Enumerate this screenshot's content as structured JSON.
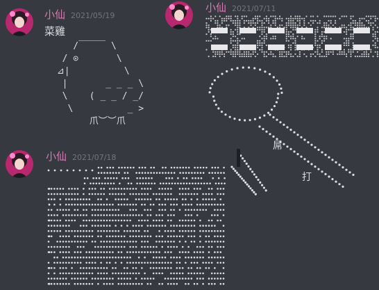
{
  "messages": [
    {
      "author": "小仙",
      "timestamp": "2021/05/19",
      "text": "菜雞",
      "ascii_art": "    /￣￣￣ \\\n  / ⊙       \\\n ⊿|          \\\n  |       _ _ _ \\\n  \\    ( _ _ / _/\n   \\          _ >\n       爪︶︶爪"
    },
    {
      "author": "小仙",
      "timestamp": "2021/07/18",
      "art": "dotted-block-art"
    },
    {
      "author": "小仙",
      "timestamp": "2021/07/11",
      "art": "dotted-banner-and-broom",
      "art_text": [
        "屌",
        "打"
      ]
    }
  ],
  "colors": {
    "background": "#36393f",
    "author": "#d97ab4",
    "timestamp": "#72767d",
    "text": "#dcddde"
  }
}
